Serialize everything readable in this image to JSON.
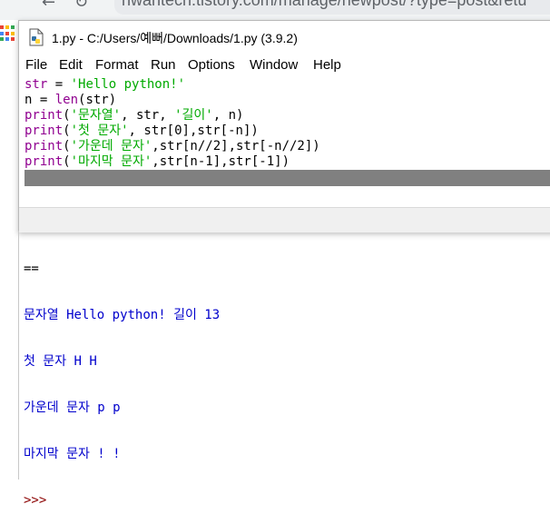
{
  "browser": {
    "url_fragment": "hwantech.tistory.com/manage/newpost/?type=post&retu"
  },
  "editor": {
    "title": "1.py - C:/Users/예뻐/Downloads/1.py (3.9.2)",
    "menu": [
      "File",
      "Edit",
      "Format",
      "Run",
      "Options",
      "Window",
      "Help"
    ],
    "code_lines": [
      [
        {
          "t": "str",
          "c": "bi"
        },
        {
          "t": " = ",
          "c": "tx"
        },
        {
          "t": "'Hello python!'",
          "c": "st"
        }
      ],
      [
        {
          "t": "n = ",
          "c": "tx"
        },
        {
          "t": "len",
          "c": "bi"
        },
        {
          "t": "(str)",
          "c": "tx"
        }
      ],
      [
        {
          "t": "print",
          "c": "bi"
        },
        {
          "t": "(",
          "c": "tx"
        },
        {
          "t": "'문자열'",
          "c": "st"
        },
        {
          "t": ", str, ",
          "c": "tx"
        },
        {
          "t": "'길이'",
          "c": "st"
        },
        {
          "t": ", n)",
          "c": "tx"
        }
      ],
      [
        {
          "t": "print",
          "c": "bi"
        },
        {
          "t": "(",
          "c": "tx"
        },
        {
          "t": "'첫 문자'",
          "c": "st"
        },
        {
          "t": ", str[0],str[-n])",
          "c": "tx"
        }
      ],
      [
        {
          "t": "print",
          "c": "bi"
        },
        {
          "t": "(",
          "c": "tx"
        },
        {
          "t": "'가운데 문자'",
          "c": "st"
        },
        {
          "t": ",str[n//2],str[-n//2])",
          "c": "tx"
        }
      ],
      [
        {
          "t": "print",
          "c": "bi"
        },
        {
          "t": "(",
          "c": "tx"
        },
        {
          "t": "'마지막 문자'",
          "c": "st"
        },
        {
          "t": ",str[n-1],str[-1])",
          "c": "tx"
        }
      ]
    ]
  },
  "shell": {
    "separator": "==",
    "output_lines": [
      "문자열 Hello python! 길이 13",
      "첫 문자 H H",
      "가운데 문자 p p",
      "마지막 문자 ! !"
    ],
    "prompt": ">>>"
  },
  "colors": {
    "string": "#00aa00",
    "builtin": "#900090",
    "output": "#0000cc",
    "prompt": "#8b0000"
  }
}
